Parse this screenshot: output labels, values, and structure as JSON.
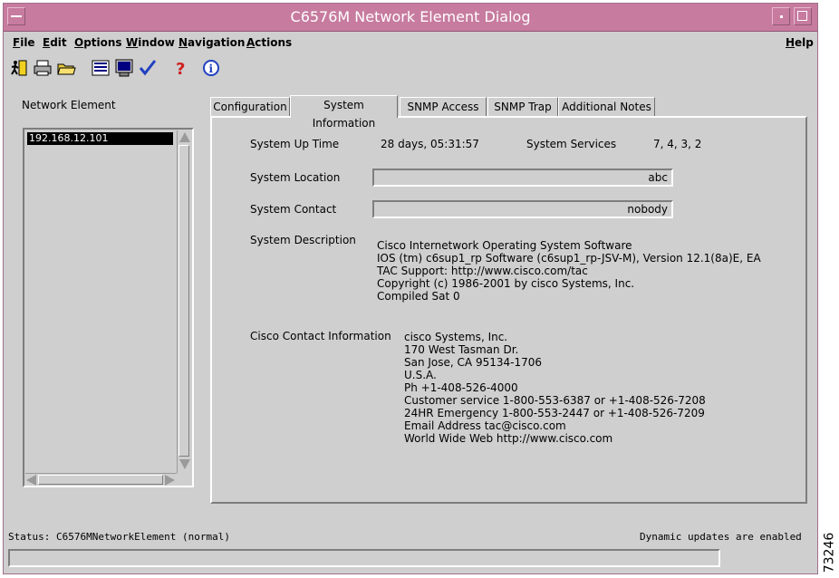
{
  "window": {
    "title": "C6576M Network Element Dialog"
  },
  "menubar": {
    "items": [
      {
        "label": "File",
        "mnemonic": "F",
        "rest": "ile"
      },
      {
        "label": "Edit",
        "mnemonic": "E",
        "rest": "dit"
      },
      {
        "label": "Options",
        "mnemonic": "O",
        "rest": "ptions"
      },
      {
        "label": "Window",
        "mnemonic": "W",
        "rest": "indow"
      },
      {
        "label": "Navigation",
        "mnemonic": "N",
        "rest": "avigation"
      },
      {
        "label": "Actions",
        "mnemonic": "A",
        "rest": "ctions"
      }
    ],
    "help": {
      "label": "Help",
      "mnemonic": "H",
      "rest": "elp"
    }
  },
  "toolbar": {
    "icons": [
      "exit-icon",
      "print-icon",
      "open-folder-icon",
      "list-icon",
      "monitor-icon",
      "check-icon",
      "help-icon",
      "info-icon"
    ]
  },
  "network_element": {
    "label": "Network Element",
    "items": [
      "192.168.12.101"
    ]
  },
  "tabs": [
    {
      "label": "Configuration",
      "active": false
    },
    {
      "label": "System Information",
      "active": true
    },
    {
      "label": "SNMP Access",
      "active": false
    },
    {
      "label": "SNMP Trap",
      "active": false
    },
    {
      "label": "Additional Notes",
      "active": false
    }
  ],
  "system_info": {
    "uptime_label": "System Up Time",
    "uptime_value": "28 days, 05:31:57",
    "services_label": "System Services",
    "services_value": "7, 4, 3, 2",
    "location_label": "System Location",
    "location_value": "abc",
    "contact_label": "System Contact",
    "contact_value": "nobody",
    "description_label": "System Description",
    "description_lines": [
      "Cisco Internetwork Operating System Software",
      "IOS (tm) c6sup1_rp Software (c6sup1_rp-JSV-M), Version 12.1(8a)E, EA",
      "TAC Support: http://www.cisco.com/tac",
      "Copyright (c) 1986-2001 by cisco Systems, Inc.",
      "Compiled Sat 0"
    ],
    "cisco_contact_label": "Cisco Contact Information",
    "cisco_contact_lines": [
      "cisco Systems, Inc.",
      "170 West Tasman Dr.",
      "San Jose, CA  95134-1706",
      "U.S.A.",
      "Ph +1-408-526-4000",
      "Customer service 1-800-553-6387 or +1-408-526-7208",
      "24HR Emergency 1-800-553-2447 or +1-408-526-7209",
      "Email Address tac@cisco.com",
      "World Wide Web http://www.cisco.com"
    ]
  },
  "status": {
    "text": "Status: C6576MNetworkElement (normal)",
    "dynamic": "Dynamic updates are enabled"
  },
  "figure_id": "73246"
}
